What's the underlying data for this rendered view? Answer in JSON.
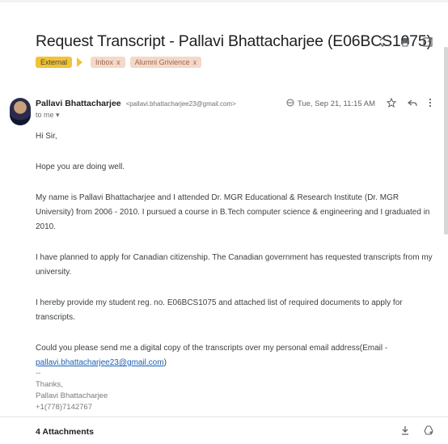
{
  "email": {
    "subject": "Request Transcript - Pallavi Bhattacharjee (E06BCS1075)",
    "labels": [
      {
        "text": "External"
      },
      {
        "text": "Inbox",
        "close": "x"
      },
      {
        "text": "Alumni Grivience",
        "close": "x"
      }
    ],
    "sender_name": "Pallavi Bhattacharjee",
    "sender_email": "<pallavi.bhattacharjee23@gmail.com>",
    "to": "to me ▾",
    "date": "Tue, Sep 21, 11:15 AM",
    "body": {
      "greeting": "Hi Sir,",
      "p1": "Hope you are doing well.",
      "p2": "My name is Pallavi Bhattacharjee and I attended Dr. MGR Educational & Research Institute (Dr. MGR University) from 2006 - 2010. I pursued a course in B.Tech computer science & engineering and I graduated in 2010.",
      "p3": "I have planned to apply for Canadian citizenship. The Canadian government has requested transcripts from my university.",
      "p4": "I hereby provide my student reg. no. E06BCS1075 and attached list of required documents to apply for transcripts.",
      "p5_prefix": "Could you please send me a digital copy of the transcripts over my personal email address(Email - ",
      "p5_link": "pallavi.bhattacharjee23@gmail.com",
      "p5_suffix": ")"
    },
    "signature": {
      "dashes": "--",
      "thanks": "Thanks,",
      "name": "Pallavi Bhattacharjee",
      "phone": "+1(778)7142767"
    },
    "attachments_label": "4 Attachments"
  },
  "icons": {
    "expand": "up-down-arrows-icon",
    "print": "printer-icon",
    "open_new": "new-window-icon",
    "star": "star-icon",
    "reply": "reply-icon",
    "more": "more-vert-icon",
    "download": "download-icon",
    "drive": "add-to-drive-icon",
    "label_arrow": "importance-marker-icon",
    "date_icon": "attachment-indicator-icon"
  },
  "colors": {
    "external_label": "#f2c335",
    "label_bg": "#f4d8c8",
    "link": "#1a5fb4"
  }
}
